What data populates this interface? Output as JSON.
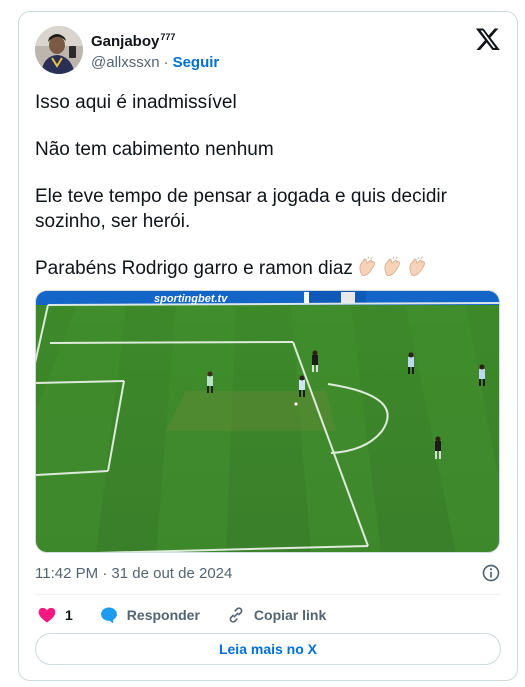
{
  "author": {
    "display_name": "Ganjaboy",
    "superscript": "777",
    "handle": "@allxssxn",
    "separator": "·",
    "follow_label": "Seguir"
  },
  "tweet": {
    "paragraphs": [
      "Isso aqui é inadmissível",
      "Não tem cabimento nenhum",
      "Ele teve tempo de pensar a jogada e quis decidir sozinho, ser herói.",
      "Parabéns Rodrigo garro e ramon diaz"
    ],
    "emoji": [
      "clapping-hands",
      "clapping-hands",
      "clapping-hands"
    ]
  },
  "media": {
    "board_text": "sportingbet.tv"
  },
  "meta": {
    "timestamp": "11:42 PM · 31 de out de 2024"
  },
  "actions": {
    "like_count": "1",
    "reply_label": "Responder",
    "copy_link_label": "Copiar link"
  },
  "read_more_label": "Leia mais no X",
  "colors": {
    "link_blue": "#006fd6",
    "like_red": "#f91880",
    "reply_blue": "#1d9bf0",
    "muted": "#536471",
    "pitch_green": "#3f8a2c"
  }
}
